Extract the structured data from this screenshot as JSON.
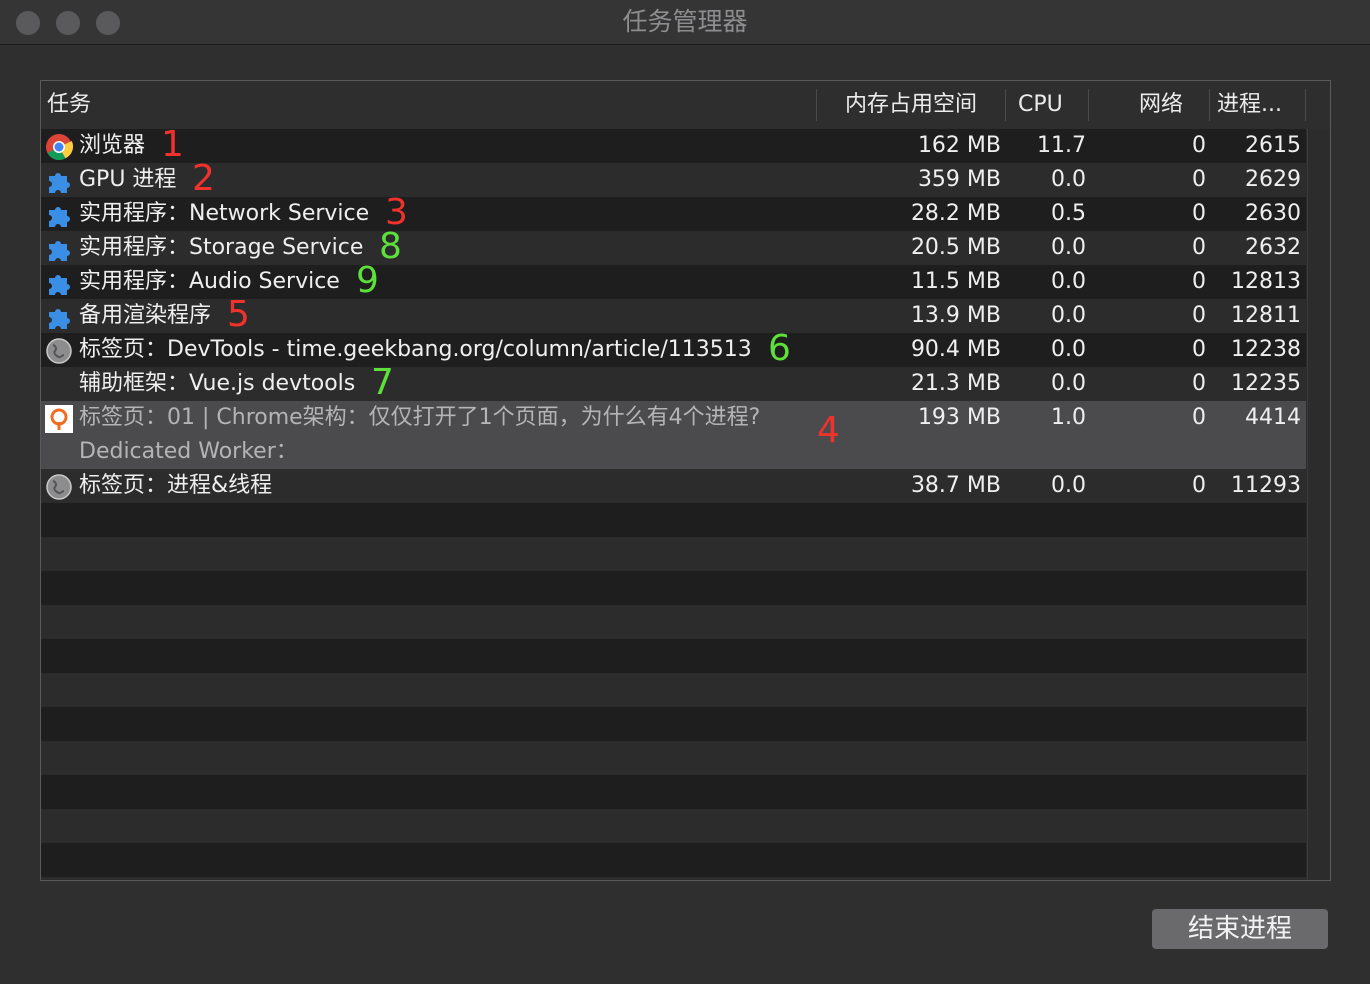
{
  "window": {
    "title": "任务管理器"
  },
  "columns": {
    "task": "任务",
    "memory": "内存占用空间",
    "cpu": "CPU",
    "network": "网络",
    "process": "进程..."
  },
  "rows": [
    {
      "icon": "chrome-icon",
      "task": "浏览器",
      "task2": "",
      "memory": "162 MB",
      "cpu": "11.7",
      "network": "0",
      "pid": "2615",
      "annotation": "1",
      "annotation_color": "red"
    },
    {
      "icon": "puzzle-icon",
      "task": "GPU 进程",
      "task2": "",
      "memory": "359 MB",
      "cpu": "0.0",
      "network": "0",
      "pid": "2629",
      "annotation": "2",
      "annotation_color": "red"
    },
    {
      "icon": "puzzle-icon",
      "task": "实用程序：Network Service",
      "task2": "",
      "memory": "28.2 MB",
      "cpu": "0.5",
      "network": "0",
      "pid": "2630",
      "annotation": "3",
      "annotation_color": "red"
    },
    {
      "icon": "puzzle-icon",
      "task": "实用程序：Storage Service",
      "task2": "",
      "memory": "20.5 MB",
      "cpu": "0.0",
      "network": "0",
      "pid": "2632",
      "annotation": "8",
      "annotation_color": "green"
    },
    {
      "icon": "puzzle-icon",
      "task": "实用程序：Audio Service",
      "task2": "",
      "memory": "11.5 MB",
      "cpu": "0.0",
      "network": "0",
      "pid": "12813",
      "annotation": "9",
      "annotation_color": "green"
    },
    {
      "icon": "puzzle-icon",
      "task": "备用渲染程序",
      "task2": "",
      "memory": "13.9 MB",
      "cpu": "0.0",
      "network": "0",
      "pid": "12811",
      "annotation": "5",
      "annotation_color": "red"
    },
    {
      "icon": "globe-icon",
      "task": "标签页：DevTools - time.geekbang.org/column/article/113513",
      "task2": "",
      "memory": "90.4 MB",
      "cpu": "0.0",
      "network": "0",
      "pid": "12238",
      "annotation": "6",
      "annotation_color": "green"
    },
    {
      "icon": "",
      "task": "辅助框架：Vue.js devtools",
      "task2": "",
      "memory": "21.3 MB",
      "cpu": "0.0",
      "network": "0",
      "pid": "12235",
      "annotation": "7",
      "annotation_color": "green"
    },
    {
      "icon": "geekbang-icon",
      "task": "标签页：01 | Chrome架构：仅仅打开了1个页面，为什么有4个进程?",
      "task2": "Dedicated Worker：",
      "memory": "193 MB",
      "cpu": "1.0",
      "network": "0",
      "pid": "4414",
      "annotation": "4",
      "annotation_color": "red"
    },
    {
      "icon": "globe-icon",
      "task": "标签页：进程&线程",
      "task2": "",
      "memory": "38.7 MB",
      "cpu": "0.0",
      "network": "0",
      "pid": "11293",
      "annotation": "",
      "annotation_color": ""
    }
  ],
  "buttons": {
    "end_process": "结束进程"
  },
  "colors": {
    "annotation_red": "#f0322d",
    "annotation_green": "#5ee03a",
    "selected_row": "#4b4b4d"
  }
}
